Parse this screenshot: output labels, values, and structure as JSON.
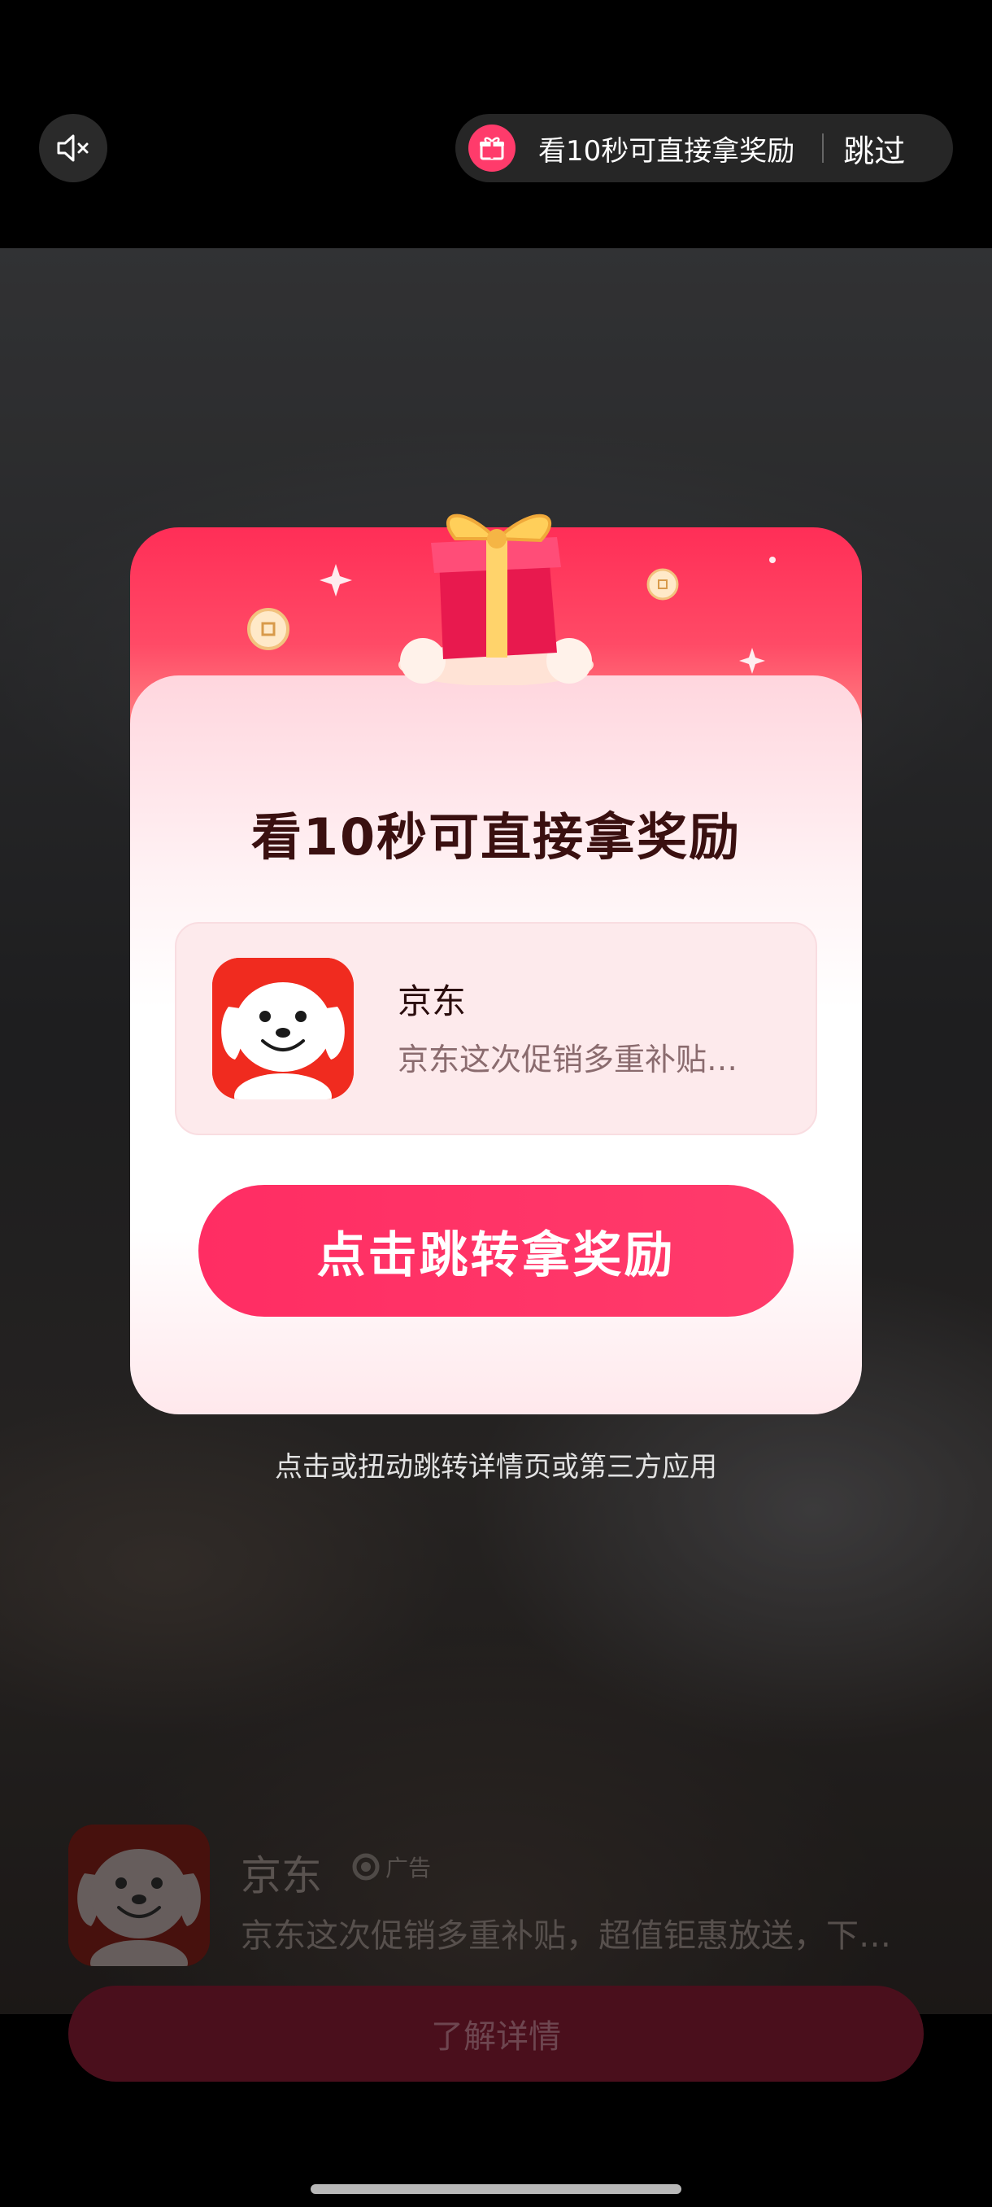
{
  "topbar": {
    "mute_icon": "speaker-muted-icon",
    "reward_text": "看10秒可直接拿奖励",
    "gift_icon": "gift-icon",
    "skip_label": "跳过"
  },
  "modal": {
    "title": "看10秒可直接拿奖励",
    "app": {
      "name": "京东",
      "description": "京东这次促销多重补贴…",
      "icon": "jd-dog-logo-icon"
    },
    "cta_label": "点击跳转拿奖励"
  },
  "hint": "点击或扭动跳转详情页或第三方应用",
  "ad": {
    "name": "京东",
    "badge": "广告",
    "description": "京东这次促销多重补贴，超值钜惠放送，下…",
    "button_label": "了解详情"
  },
  "colors": {
    "accent": "#ff2d63",
    "modal_header": "#ff2e57",
    "jd_red": "#f02b1f"
  }
}
